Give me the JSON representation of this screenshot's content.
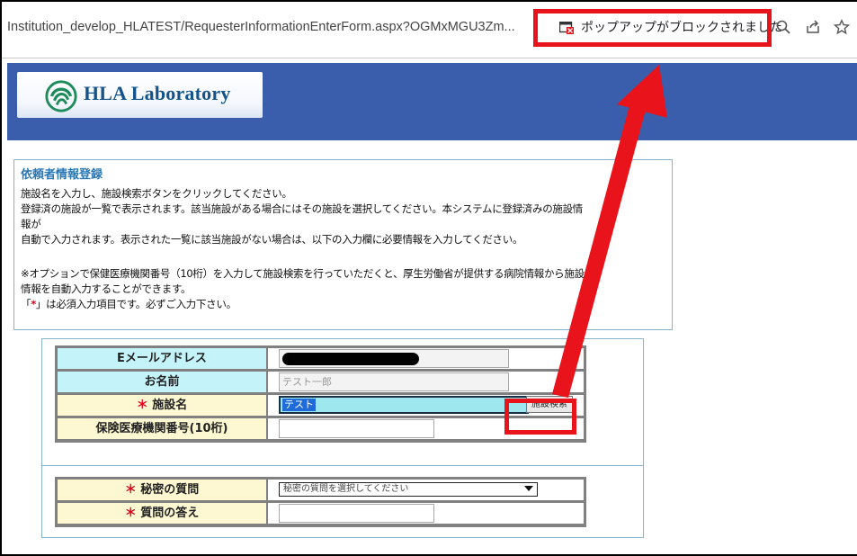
{
  "browser": {
    "url": "Institution_develop_HLATEST/RequesterInformationEnterForm.aspx?OGMxMGU3Zm...",
    "popup_blocked": "ポップアップがブロックされました",
    "icons": [
      "popup-blocked-icon",
      "zoom-icon",
      "share-icon",
      "bookmark-star-icon"
    ]
  },
  "header": {
    "logo_text": "HLA Laboratory"
  },
  "info": {
    "title": "依頼者情報登録",
    "line1": "施設名を入力し、施設検索ボタンをクリックしてください。",
    "line2": "登録済の施設が一覧で表示されます。該当施設がある場合にはその施設を選択してください。本システムに登録済みの施設情",
    "line3": "報が",
    "line4": "自動で入力されます。表示された一覧に該当施設がない場合は、以下の入力欄に必要情報を入力してください。",
    "line5": "※オプションで保健医療機関番号（10桁）を入力して施設検索を行っていただくと、厚生労働省が提供する病院情報から施設の",
    "line6": "情報を自動入力することができます。",
    "line7_open": "「",
    "line7_star": "*",
    "line7_rest": "」は必須入力項目です。必ずご入力下さい。"
  },
  "form": {
    "email_label": "Eメールアドレス",
    "name_label": "お名前",
    "name_value": "テスト一郎",
    "facility_label": "施設名",
    "facility_value": "テスト",
    "search_button": "施設検索",
    "insurance_label": "保険医療機関番号(10桁)",
    "secret_q_label": "秘密の質問",
    "secret_q_placeholder": "秘密の質問を選択してください",
    "secret_a_label": "質問の答え",
    "required_mark": "＊"
  },
  "annotation": {
    "color": "#e8131b"
  }
}
